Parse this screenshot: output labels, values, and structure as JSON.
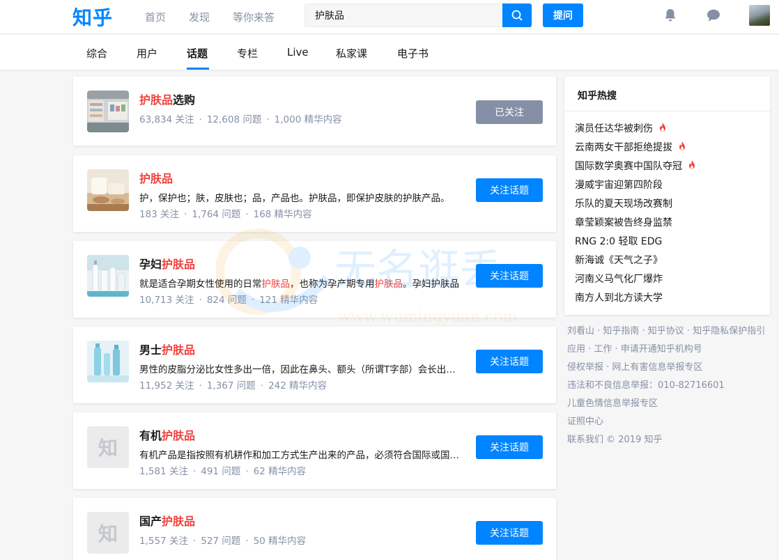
{
  "header": {
    "logo": "知乎",
    "nav": [
      "首页",
      "发现",
      "等你来答"
    ],
    "search": {
      "value": "护肤品",
      "placeholder": ""
    },
    "ask_label": "提问",
    "icons": [
      "search-icon",
      "bell-icon",
      "message-icon",
      "avatar"
    ]
  },
  "tabs": {
    "items": [
      "综合",
      "用户",
      "话题",
      "专栏",
      "Live",
      "私家课",
      "电子书"
    ],
    "active": "话题"
  },
  "results": [
    {
      "title_hl": "护肤品",
      "title_rest": "选购",
      "hl_first": true,
      "desc": "",
      "followers": "63,834 关注",
      "questions": "12,608 问题",
      "featured": "1,000 精华内容",
      "button": "已关注",
      "followed": true,
      "thumb": "photo-shop"
    },
    {
      "title_hl": "护肤品",
      "title_rest": "",
      "hl_first": true,
      "desc": "护，保护也；肤，皮肤也；品，产品也。护肤品，即保护皮肤的护肤产品。",
      "followers": "183 关注",
      "questions": "1,764 问题",
      "featured": "168 精华内容",
      "button": "关注话题",
      "followed": false,
      "thumb": "photo-towels"
    },
    {
      "title_pre": "孕妇",
      "title_hl": "护肤品",
      "hl_first": false,
      "desc_parts": [
        "就是适合孕期女性使用的日常",
        "护肤品",
        "，也称为孕产期专用",
        "护肤品",
        "。孕妇护肤品"
      ],
      "followers": "10,713 关注",
      "questions": "824 问题",
      "featured": "121 精华内容",
      "button": "关注话题",
      "followed": false,
      "thumb": "photo-bottles"
    },
    {
      "title_pre": "男士",
      "title_hl": "护肤品",
      "hl_first": false,
      "desc": "男性的皮脂分泌比女性多出一倍，因此在鼻头、额头（所谓T字部）会长出粉刺",
      "followers": "11,952 关注",
      "questions": "1,367 问题",
      "featured": "242 精华内容",
      "button": "关注话题",
      "followed": false,
      "thumb": "photo-blue-bottles"
    },
    {
      "title_pre": "有机",
      "title_hl": "护肤品",
      "hl_first": false,
      "desc": "有机产品是指按照有机耕作和加工方式生产出来的产品，必须符合国际或国家有机标准",
      "followers": "1,581 关注",
      "questions": "491 问题",
      "featured": "62 精华内容",
      "button": "关注话题",
      "followed": false,
      "thumb": "placeholder",
      "placeholder_char": "知"
    },
    {
      "title_pre": "国产",
      "title_hl": "护肤品",
      "hl_first": false,
      "desc": "",
      "followers": "1,557 关注",
      "questions": "527 问题",
      "featured": "50 精华内容",
      "button": "关注话题",
      "followed": false,
      "thumb": "placeholder",
      "placeholder_char": "知"
    }
  ],
  "hot_search": {
    "title": "知乎热搜",
    "items": [
      {
        "text": "演员任达华被刺伤",
        "hot": true
      },
      {
        "text": "云南两女干部拒绝提拔",
        "hot": true
      },
      {
        "text": "国际数学奥赛中国队夺冠",
        "hot": true
      },
      {
        "text": "漫威宇宙迎第四阶段",
        "hot": false
      },
      {
        "text": "乐队的夏天现场改赛制",
        "hot": false
      },
      {
        "text": "章莹颖案被告终身监禁",
        "hot": false
      },
      {
        "text": "RNG 2:0 轻取 EDG",
        "hot": false
      },
      {
        "text": "新海诚《天气之子》",
        "hot": false
      },
      {
        "text": "河南义马气化厂爆炸",
        "hot": false
      },
      {
        "text": "南方人到北方读大学",
        "hot": false
      }
    ]
  },
  "footer": [
    "刘看山 · 知乎指南 · 知乎协议 · 知乎隐私保护指引",
    "应用 · 工作 · 申请开通知乎机构号",
    "侵权举报 · 网上有害信息举报专区",
    "违法和不良信息举报：010-82716601",
    "儿童色情信息举报专区",
    "证照中心",
    "联系我们 © 2019 知乎"
  ],
  "watermark": "无名逛丢 www.wumingyuan.com",
  "colors": {
    "brand": "#0084ff",
    "highlight": "#f1403c",
    "meta": "#8590a6",
    "fire": "#f1403c"
  }
}
